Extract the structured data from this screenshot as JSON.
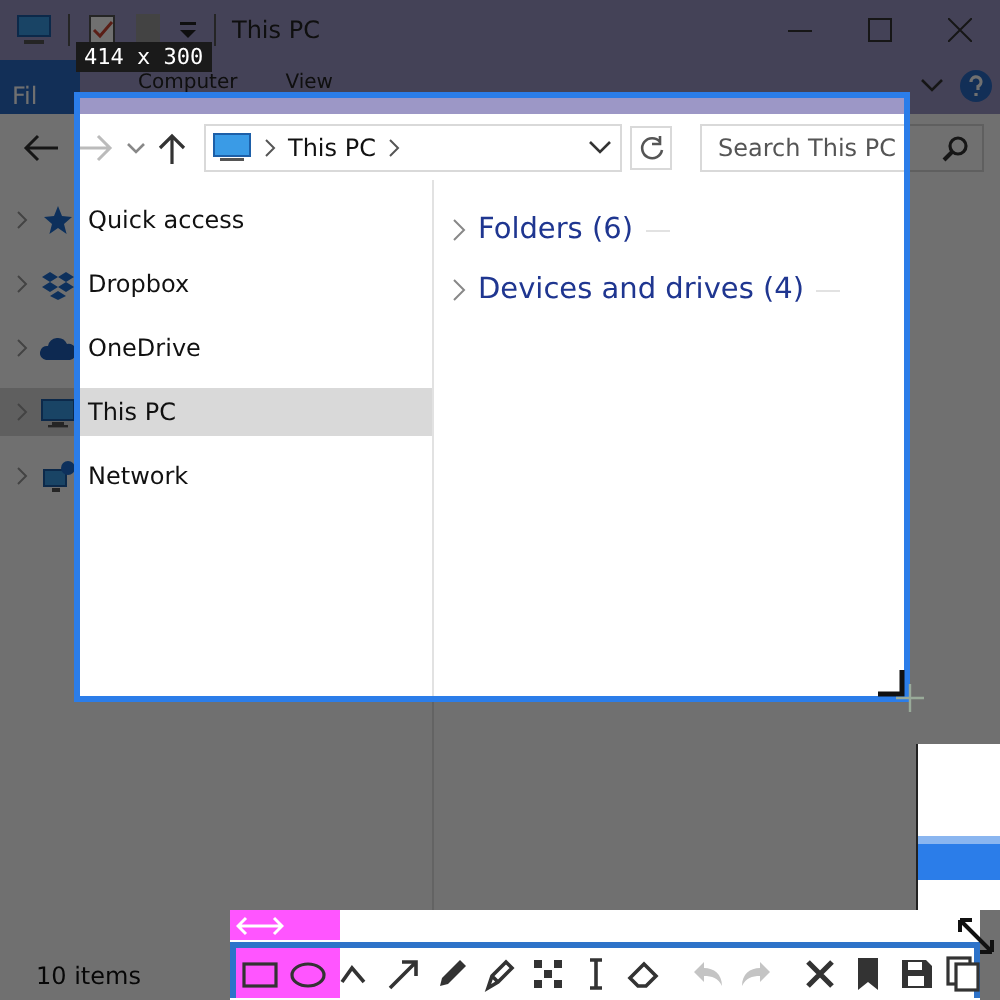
{
  "capture": {
    "size_label": "414 x 300"
  },
  "window": {
    "title": "This PC"
  },
  "ribbon_tabs": [
    {
      "label": "Fil",
      "selected": true
    },
    {
      "label": "Computer",
      "selected": false
    },
    {
      "label": "View",
      "selected": false
    }
  ],
  "address": {
    "location": "This PC"
  },
  "search": {
    "placeholder": "Search This PC"
  },
  "sidebar": {
    "items": [
      {
        "label": "Quick access",
        "kind": "star",
        "selected": false
      },
      {
        "label": "Dropbox",
        "kind": "boxes",
        "selected": false
      },
      {
        "label": "OneDrive",
        "kind": "cloud",
        "selected": false
      },
      {
        "label": "This PC",
        "kind": "monitor",
        "selected": true
      },
      {
        "label": "Network",
        "kind": "network",
        "selected": false
      }
    ]
  },
  "groups": [
    {
      "label": "Folders (6)"
    },
    {
      "label": "Devices and drives (4)"
    }
  ],
  "status_bar": {
    "text": "10 items"
  },
  "toolbar": {
    "tools": [
      {
        "kind": "rect",
        "disabled": false
      },
      {
        "kind": "ellipse",
        "disabled": false
      },
      {
        "kind": "line",
        "disabled": false
      },
      {
        "kind": "arrow",
        "disabled": false
      },
      {
        "kind": "pencil",
        "disabled": false
      },
      {
        "kind": "marker",
        "disabled": false
      },
      {
        "kind": "mosaic",
        "disabled": false
      },
      {
        "kind": "text",
        "disabled": false
      },
      {
        "kind": "eraser",
        "disabled": false
      },
      {
        "kind": "separator"
      },
      {
        "kind": "undo",
        "disabled": true
      },
      {
        "kind": "redo",
        "disabled": true
      },
      {
        "kind": "separator"
      },
      {
        "kind": "close",
        "disabled": false
      },
      {
        "kind": "pin",
        "disabled": false
      },
      {
        "kind": "save",
        "disabled": false
      },
      {
        "kind": "copy",
        "disabled": false
      }
    ]
  }
}
